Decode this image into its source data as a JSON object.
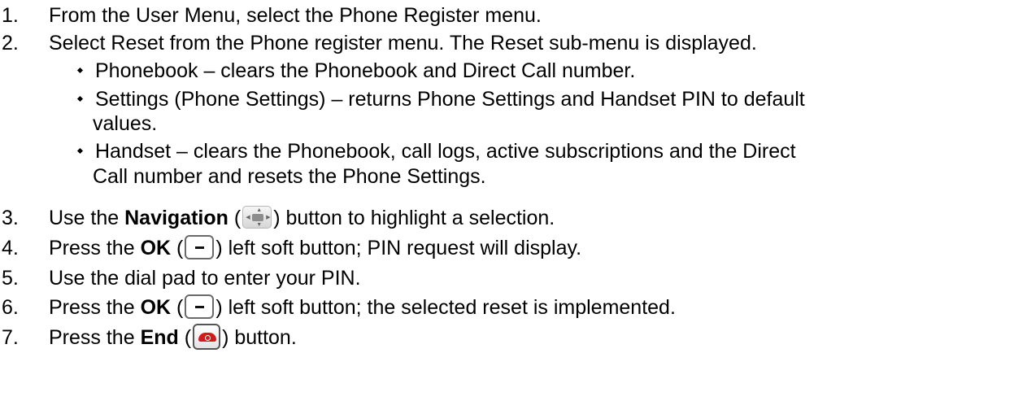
{
  "steps": [
    {
      "num": "1.",
      "text": "From the User Menu, select the Phone Register menu."
    },
    {
      "num": "2.",
      "text": "Select Reset from the Phone register menu.  The Reset sub-menu is displayed."
    },
    {
      "num": "3.",
      "pre": "Use the ",
      "bold": "Navigation",
      "mid": " (",
      "post": ") button to highlight a selection.",
      "icon": "navigation-button-icon"
    },
    {
      "num": "4.",
      "pre": "Press the ",
      "bold": "OK",
      "mid": " (",
      "post": ") left soft button; PIN request will display.",
      "icon": "soft-button-icon"
    },
    {
      "num": "5.",
      "text": "Use the dial pad to enter your PIN."
    },
    {
      "num": "6.",
      "pre": "Press the ",
      "bold": "OK",
      "mid": " (",
      "post": ") left soft button; the selected reset is implemented.",
      "icon": "soft-button-icon"
    },
    {
      "num": "7.",
      "pre": "Press the ",
      "bold": "End",
      "mid": " (",
      "post": ") button.",
      "icon": "end-call-button-icon"
    }
  ],
  "sub_items": [
    {
      "lines": [
        "Phonebook – clears the Phonebook and Direct Call number."
      ]
    },
    {
      "lines": [
        "Settings (Phone Settings) – returns Phone Settings and Handset PIN to default",
        "values."
      ]
    },
    {
      "lines": [
        "Handset – clears the Phonebook, call logs, active subscriptions and the Direct",
        "Call number and resets the Phone Settings."
      ]
    }
  ],
  "icon_labels": {
    "ok": "OK"
  }
}
